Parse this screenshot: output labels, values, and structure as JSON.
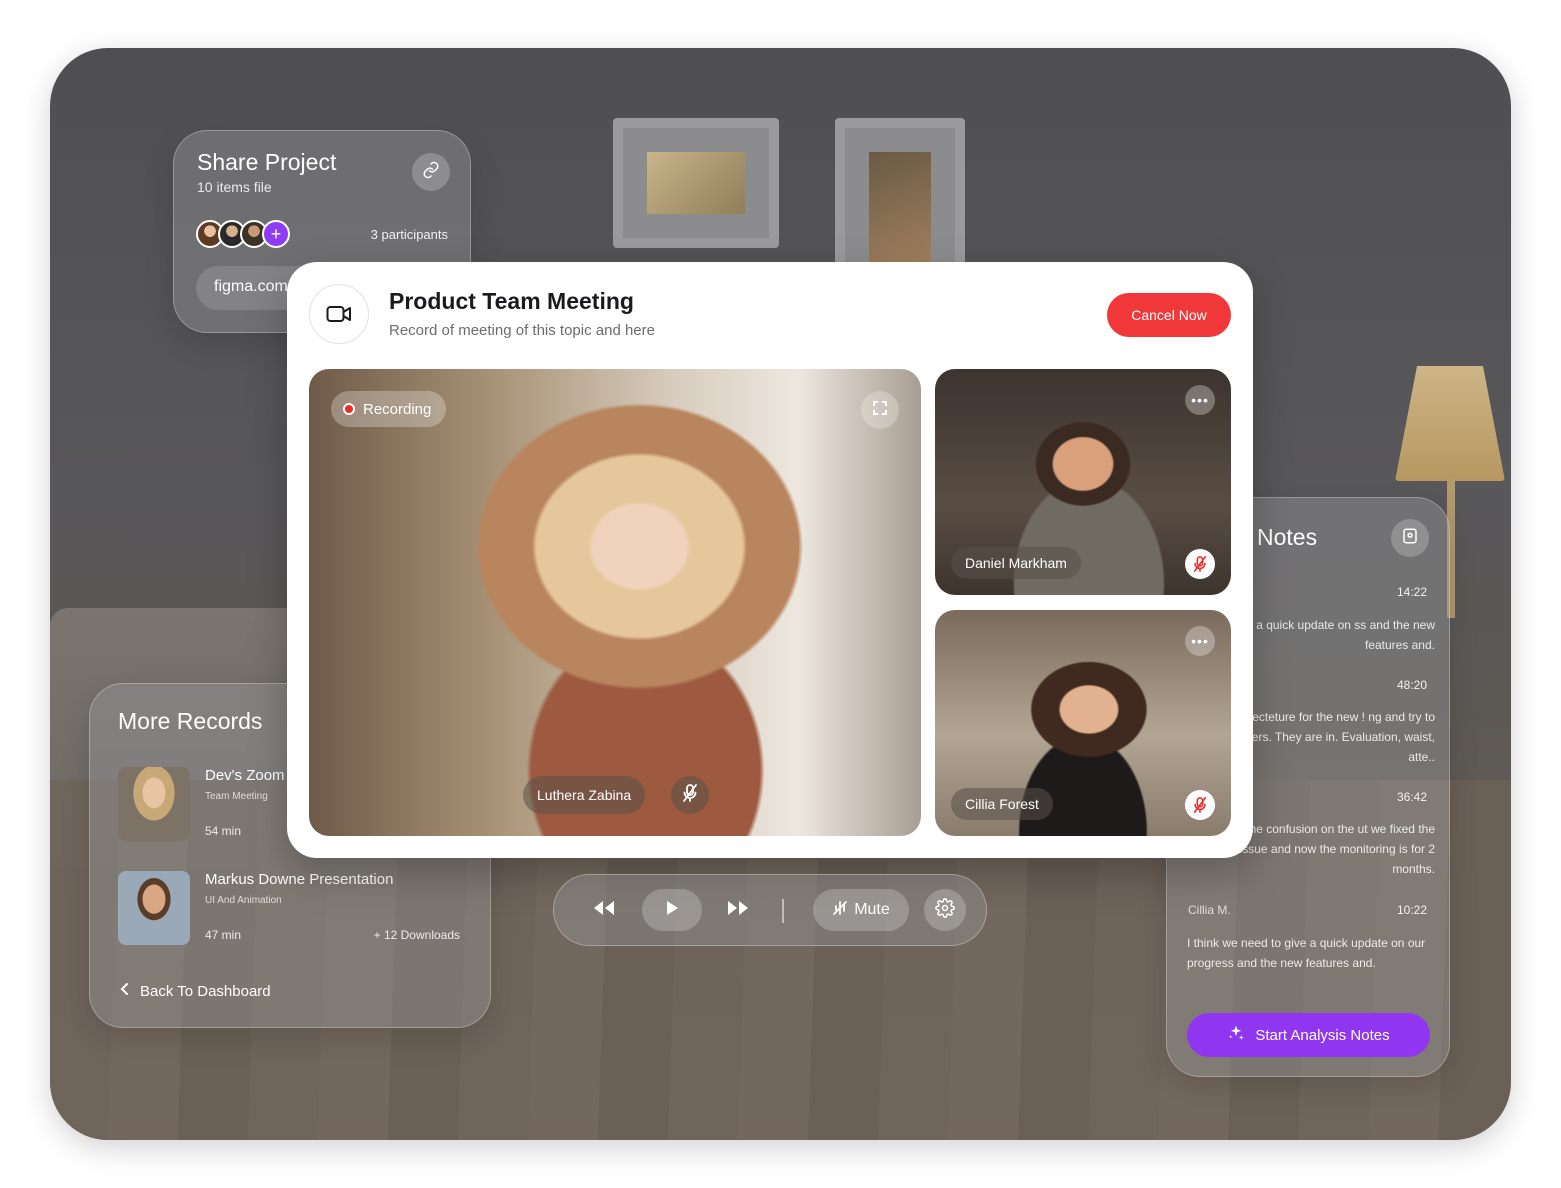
{
  "share": {
    "title": "Share Project",
    "subtitle": "10 items file",
    "participants": "3 participants",
    "url": "figma.com"
  },
  "meeting": {
    "title": "Product Team Meeting",
    "subtitle": "Record of meeting of this topic and here",
    "cancel_label": "Cancel Now",
    "recording_label": "Recording",
    "main_speaker": "Luthera Zabina",
    "participants": [
      {
        "name": "Daniel Markham"
      },
      {
        "name": "Cillia Forest"
      }
    ]
  },
  "records": {
    "title": "More Records",
    "items": [
      {
        "name": "Dev's Zoom",
        "category": "Team Meeting",
        "duration": "54 min",
        "downloads": ""
      },
      {
        "name": "Markus Downe Presentation",
        "category": "UI And Animation",
        "duration": "47 min",
        "downloads": "+ 12 Downloads"
      }
    ],
    "back_label": "Back To Dashboard"
  },
  "notes": {
    "title": "Notes",
    "entries": [
      {
        "time": "14:22",
        "text": "we do give a quick update on ss and the new features and."
      },
      {
        "time": "48:20",
        "text": "iel: Persecteture for the new ! ng and try to keep users. They are in. Evaluation, waist, atte.."
      },
      {
        "time": "36:42",
        "text": "had some confusion on the ut we fixed the technical issue and now the monitoring is for 2 months."
      },
      {
        "author": "Cillia M.",
        "time": "10:22",
        "text": "I think we need to give a quick update on our progress and the new features and."
      }
    ],
    "analysis_label": "Start Analysis Notes"
  },
  "controls": {
    "mute_label": "Mute"
  },
  "icons": {
    "link": "link-icon",
    "note": "note-icon",
    "camera": "video-camera-icon",
    "expand": "expand-icon",
    "mic": "microphone-icon",
    "mic_off": "microphone-off-icon",
    "more": "more-icon",
    "rewind": "rewind-icon",
    "play": "play-icon",
    "forward": "fast-forward-icon",
    "mute": "mute-icon",
    "settings": "gear-icon",
    "sparkle": "sparkle-icon",
    "back": "chevron-left-icon"
  },
  "colors": {
    "cancel": "#f0383a",
    "accent": "#9136f0",
    "recording": "#ee2a2a"
  }
}
